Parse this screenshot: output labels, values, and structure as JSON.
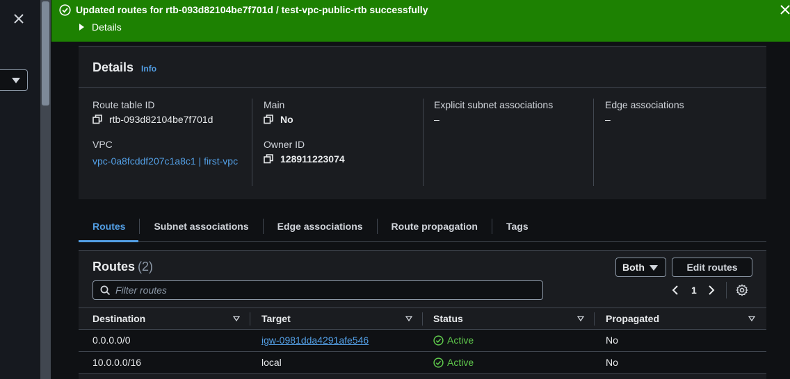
{
  "flash": {
    "message": "Updated routes for rtb-093d82104be7f701d / test-vpc-public-rtb successfully",
    "details_label": "Details",
    "color": "#1d8102"
  },
  "details": {
    "title": "Details",
    "info_label": "Info",
    "route_table_id_label": "Route table ID",
    "route_table_id": "rtb-093d82104be7f701d",
    "main_label": "Main",
    "main_value": "No",
    "explicit_subnet_label": "Explicit subnet associations",
    "explicit_subnet_value": "–",
    "edge_assoc_label": "Edge associations",
    "edge_assoc_value": "–",
    "vpc_label": "VPC",
    "vpc_value": "vpc-0a8fcddf207c1a8c1 | first-vpc",
    "owner_id_label": "Owner ID",
    "owner_id": "128911223074"
  },
  "tabs": [
    {
      "label": "Routes",
      "active": true
    },
    {
      "label": "Subnet associations",
      "active": false
    },
    {
      "label": "Edge associations",
      "active": false
    },
    {
      "label": "Route propagation",
      "active": false
    },
    {
      "label": "Tags",
      "active": false
    }
  ],
  "routes": {
    "title": "Routes",
    "count": "(2)",
    "filter_select": "Both",
    "edit_button": "Edit routes",
    "filter_placeholder": "Filter routes",
    "page": "1",
    "columns": [
      "Destination",
      "Target",
      "Status",
      "Propagated"
    ],
    "rows": [
      {
        "destination": "0.0.0.0/0",
        "target": "igw-0981dda4291afe546",
        "target_is_link": true,
        "status": "Active",
        "propagated": "No"
      },
      {
        "destination": "10.0.0.0/16",
        "target": "local",
        "target_is_link": false,
        "status": "Active",
        "propagated": "No"
      }
    ]
  },
  "colors": {
    "accent": "#539fe5",
    "success": "#5fc94c",
    "background": "#0f1114",
    "card": "#1a1c20"
  }
}
